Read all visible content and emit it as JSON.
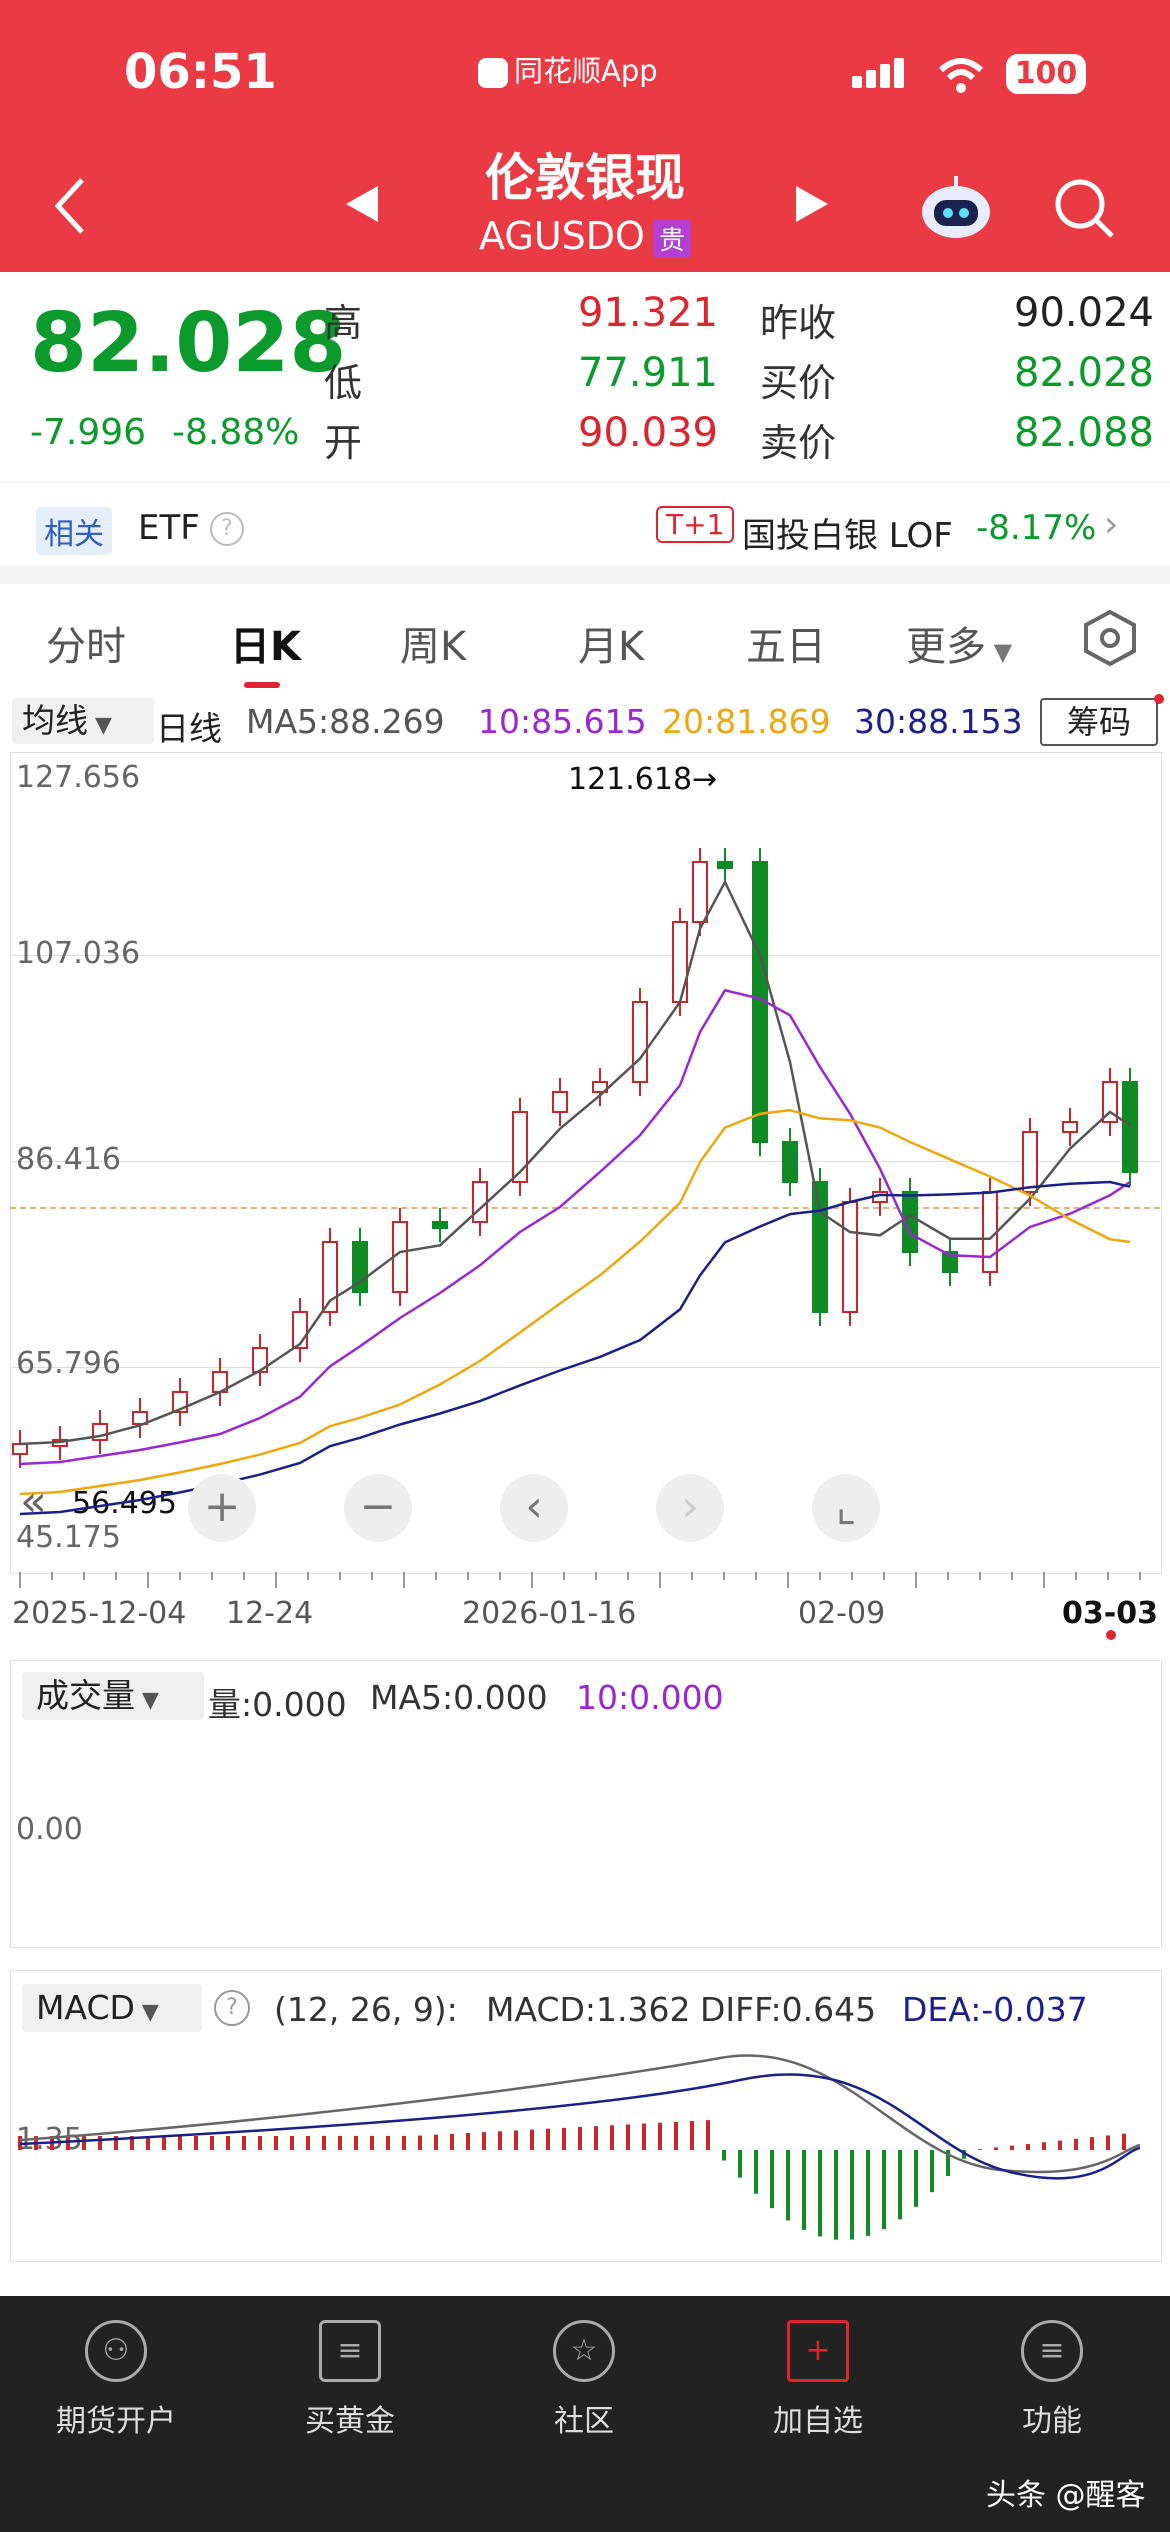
{
  "status_bar": {
    "time": "06:51",
    "app_name": "同花顺App",
    "battery": "100"
  },
  "header": {
    "title": "伦敦银现",
    "symbol": "AGUSDO",
    "tag": "贵"
  },
  "quote": {
    "price": "82.028",
    "change": "-7.996",
    "change_pct": "-8.88%",
    "high_label": "高",
    "high": "91.321",
    "low_label": "低",
    "low": "77.911",
    "open_label": "开",
    "open": "90.039",
    "prev_close_label": "昨收",
    "prev_close": "90.024",
    "bid_label": "买价",
    "bid": "82.028",
    "ask_label": "卖价",
    "ask": "82.088"
  },
  "related": {
    "label": "相关",
    "type": "ETF",
    "t1": "T+1",
    "fund": "国投白银 LOF",
    "fund_change": "-8.17%"
  },
  "tabs": [
    "分时",
    "日K",
    "周K",
    "月K",
    "五日",
    "更多"
  ],
  "active_tab": "日K",
  "kline": {
    "indicator": "均线",
    "period": "日线",
    "ma5": "MA5:88.269",
    "ma10": "10:85.615",
    "ma20": "20:81.869",
    "ma30": "30:88.153",
    "chips_button": "筹码",
    "y_labels": [
      "127.656",
      "107.036",
      "86.416",
      "65.796",
      "45.175"
    ],
    "min_label": "56.495",
    "max_annotation": "121.618→",
    "x_labels": [
      "2025-12-04",
      "12-24",
      "2026-01-16",
      "02-09",
      "03-03"
    ],
    "colors": {
      "ma5": "#555555",
      "ma10": "#9b27d4",
      "ma20": "#f0a70f",
      "ma30": "#1b1f8c",
      "up": "#c9262c",
      "down": "#0f8a24"
    }
  },
  "volume": {
    "selector": "成交量",
    "vol": "量:0.000",
    "ma5": "MA5:0.000",
    "ma10": "10:0.000",
    "zero": "0.00"
  },
  "macd": {
    "selector": "MACD",
    "params": "(12, 26, 9):",
    "macd": "MACD:1.362",
    "diff": "DIFF:0.645",
    "dea": "DEA:-0.037",
    "axis": "1.35"
  },
  "bottom_nav": [
    {
      "label": "期货开户",
      "icon": "person-icon"
    },
    {
      "label": "买黄金",
      "icon": "document-icon"
    },
    {
      "label": "社区",
      "icon": "star-badge-icon"
    },
    {
      "label": "加自选",
      "icon": "plus-square-icon"
    },
    {
      "label": "功能",
      "icon": "menu-icon"
    }
  ],
  "watermark": "头条 @醒客"
}
